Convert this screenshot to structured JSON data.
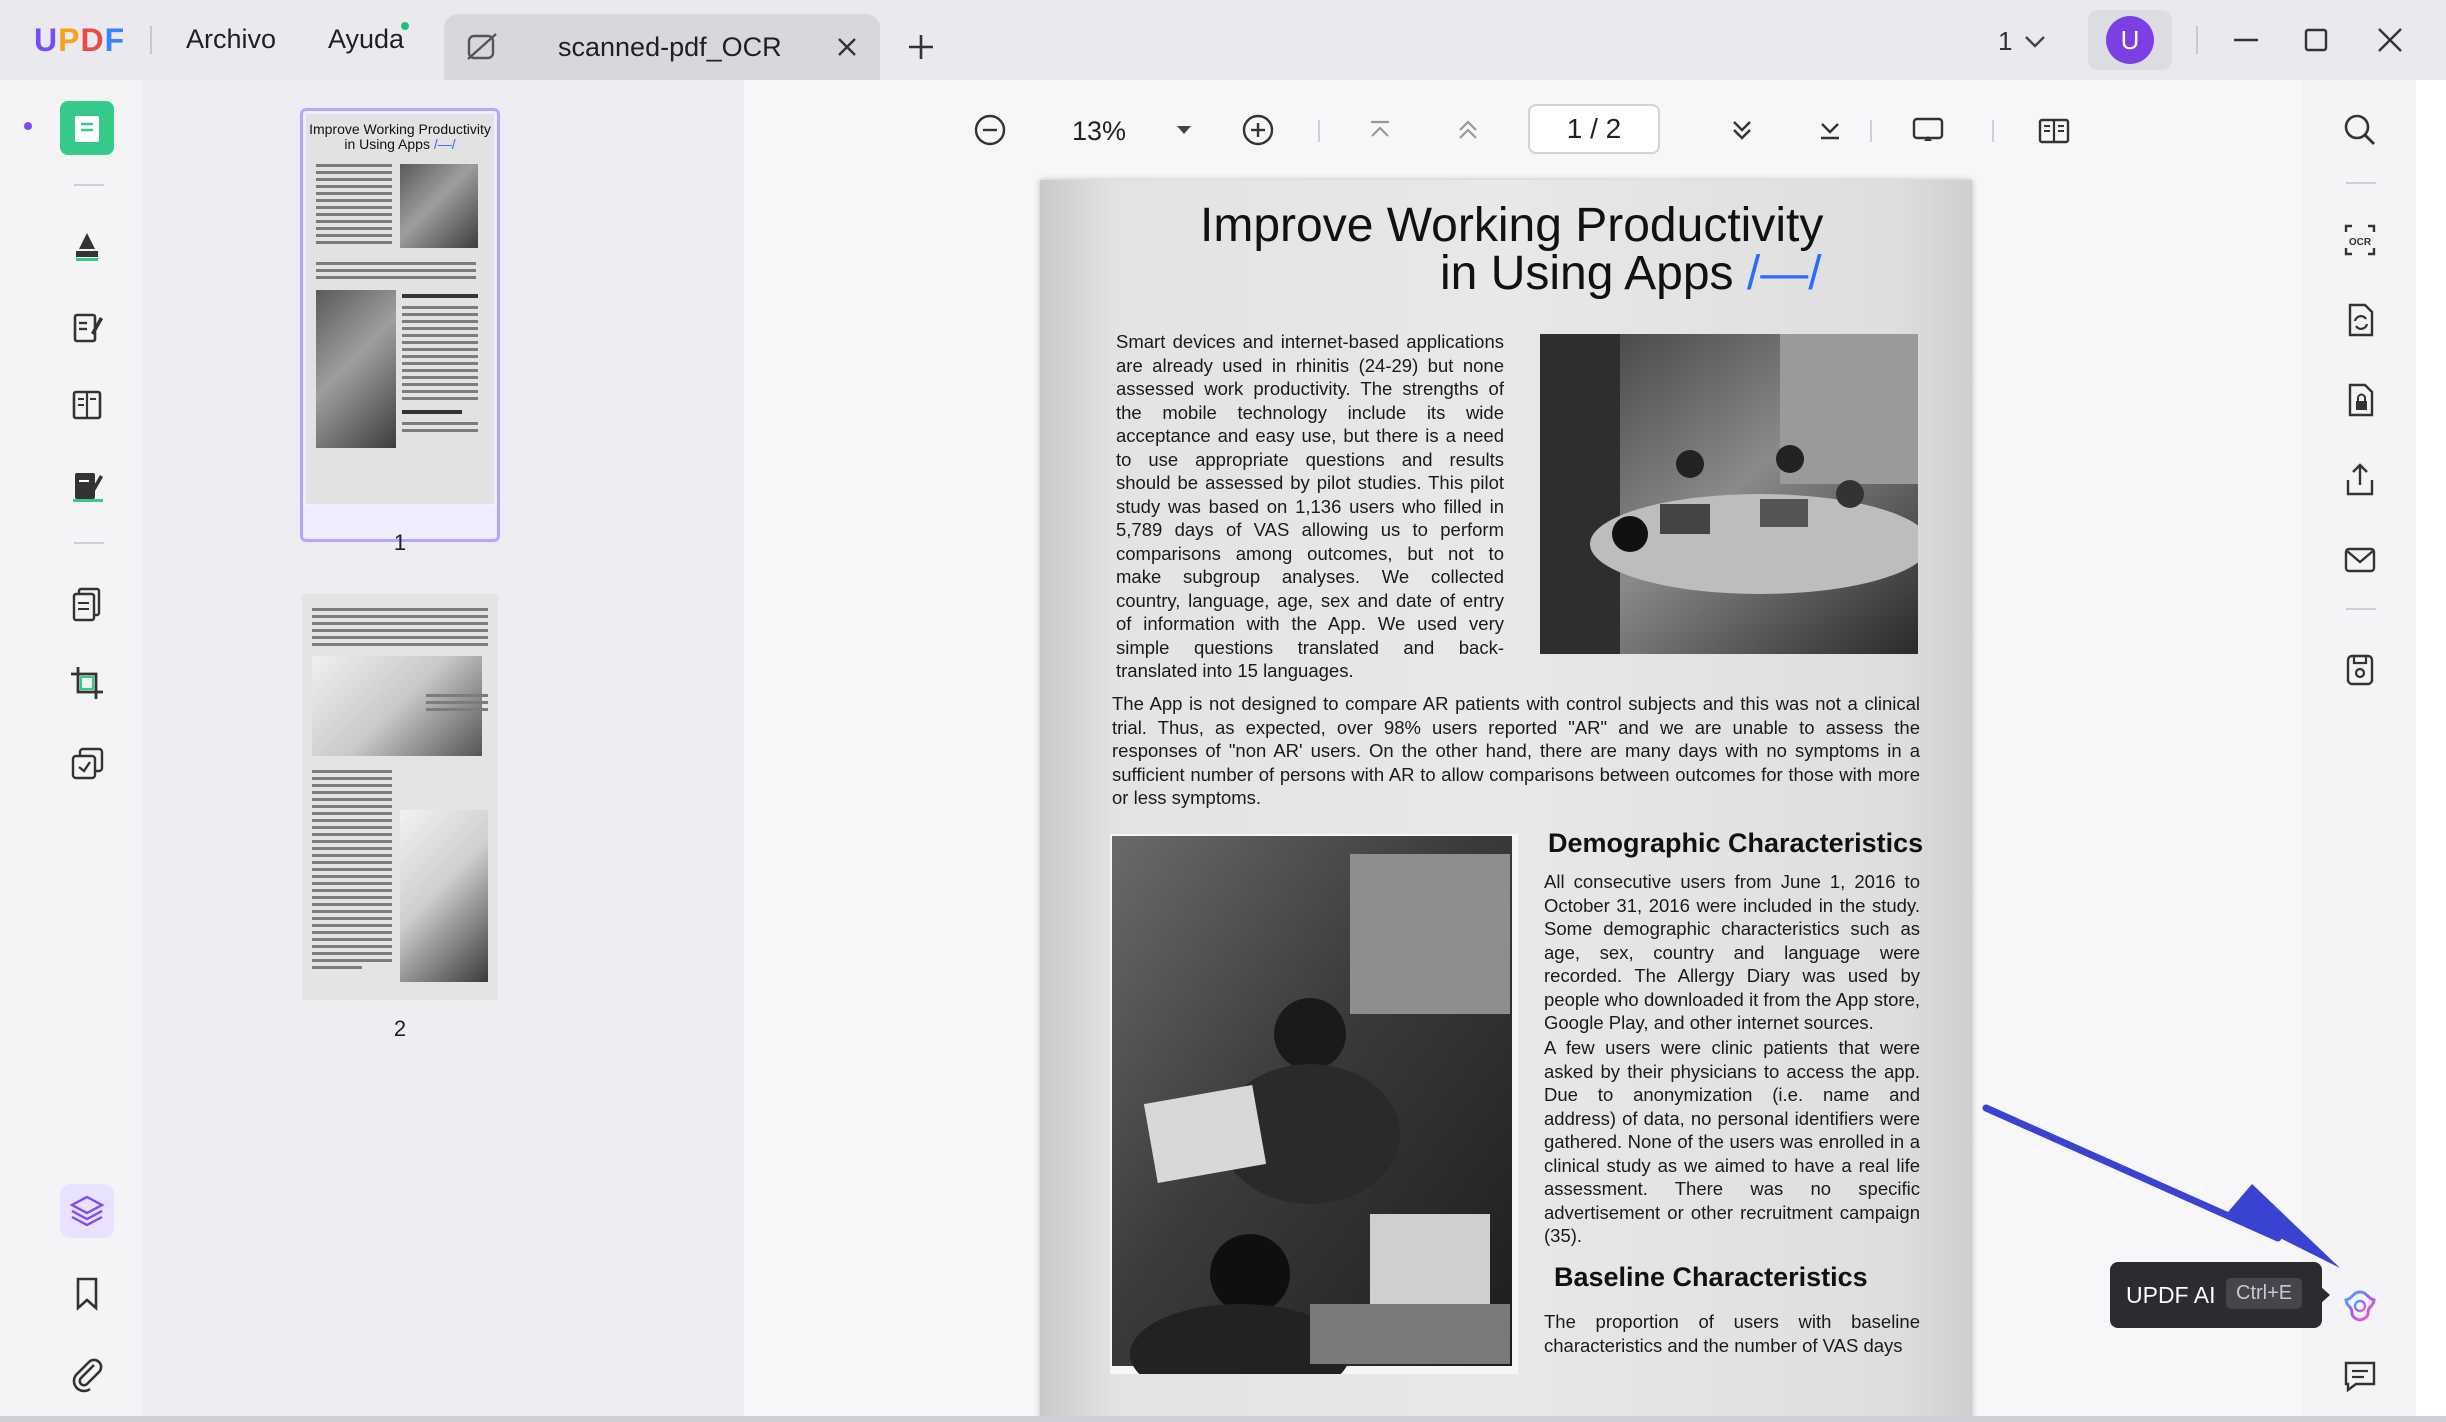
{
  "titlebar": {
    "logo": {
      "u": "U",
      "p": "P",
      "d": "D",
      "f": "F"
    },
    "menu": [
      "Archivo",
      "Ayuda"
    ],
    "tab_title": "scanned-pdf_OCR",
    "page_indicator": "1",
    "avatar_letter": "U",
    "colors": {
      "brand_purple": "#7b4cf6",
      "notification_dot": "#21c07a"
    }
  },
  "leftbar": {
    "tools": [
      "reader-icon",
      "comment-icon",
      "edit-icon",
      "organize-icon",
      "fill-sign-icon",
      "convert-icon",
      "crop-icon",
      "batch-icon"
    ],
    "bottom": [
      "layers-icon",
      "bookmark-icon",
      "attachment-icon"
    ]
  },
  "thumbnails": {
    "pages": [
      {
        "number": "1",
        "title_line1": "Improve Working Productivity",
        "title_line2": "in Using Apps",
        "accent": "/—/"
      },
      {
        "number": "2"
      }
    ]
  },
  "toolbar": {
    "zoom": "13%",
    "page_current": "1",
    "page_sep": "/",
    "page_total": "2"
  },
  "document": {
    "title_line1": "Improve Working Productivity",
    "title_line2": "in Using Apps",
    "title_accent": "/—/",
    "para1": "Smart devices and internet-based applications are already used in rhinitis (24-29) but none assessed work productivity. The strengths of the mobile technology include its wide acceptance and easy use, but there is a need to use appropriate questions and results should be assessed by pilot studies. This pilot study was based on 1,136 users who filled in 5,789 days of VAS allowing us to perform comparisons among outcomes, but not to make subgroup analyses. We collected country, language, age, sex and date of entry of information with the App. We used very simple questions translated and back-translated into 15 languages.",
    "para2": "The App is not designed to compare AR patients with control subjects and this was not a clinical trial. Thus, as expected, over 98% users reported \"AR\" and we are unable to assess the responses of \"non AR' users. On the other hand, there are many days with no symptoms in a sufficient number of persons with AR to allow comparisons between outcomes for those with more or less symptoms.",
    "heading1": "Demographic Characteristics",
    "para3": "All consecutive users from June 1, 2016 to October 31, 2016 were included in the study. Some demographic characteristics such as age, sex, country and language were recorded. The Allergy Diary was used by people who downloaded it from the App store, Google Play, and other internet sources.",
    "para4": "A few users were clinic patients that were asked by their physicians to access the app. Due to anonymization (i.e. name and address) of data, no personal identifiers were gathered. None of the users was enrolled in a clinical study as we aimed to have a real life assessment. There was no specific advertisement or other   recruitment campaign (35).",
    "heading2": "Baseline Characteristics",
    "para5": "The proportion of users with baseline characteristics and the number of VAS days"
  },
  "rightbar": {
    "tools": [
      "search-icon",
      "ocr-icon",
      "convert-icon",
      "protect-icon",
      "share-icon",
      "email-icon",
      "save-icon",
      "updf-ai-icon",
      "comments-icon"
    ]
  },
  "tooltip": {
    "label": "UPDF AI",
    "shortcut": "Ctrl+E"
  },
  "annotation": {
    "arrow_color": "#3a43d1"
  }
}
